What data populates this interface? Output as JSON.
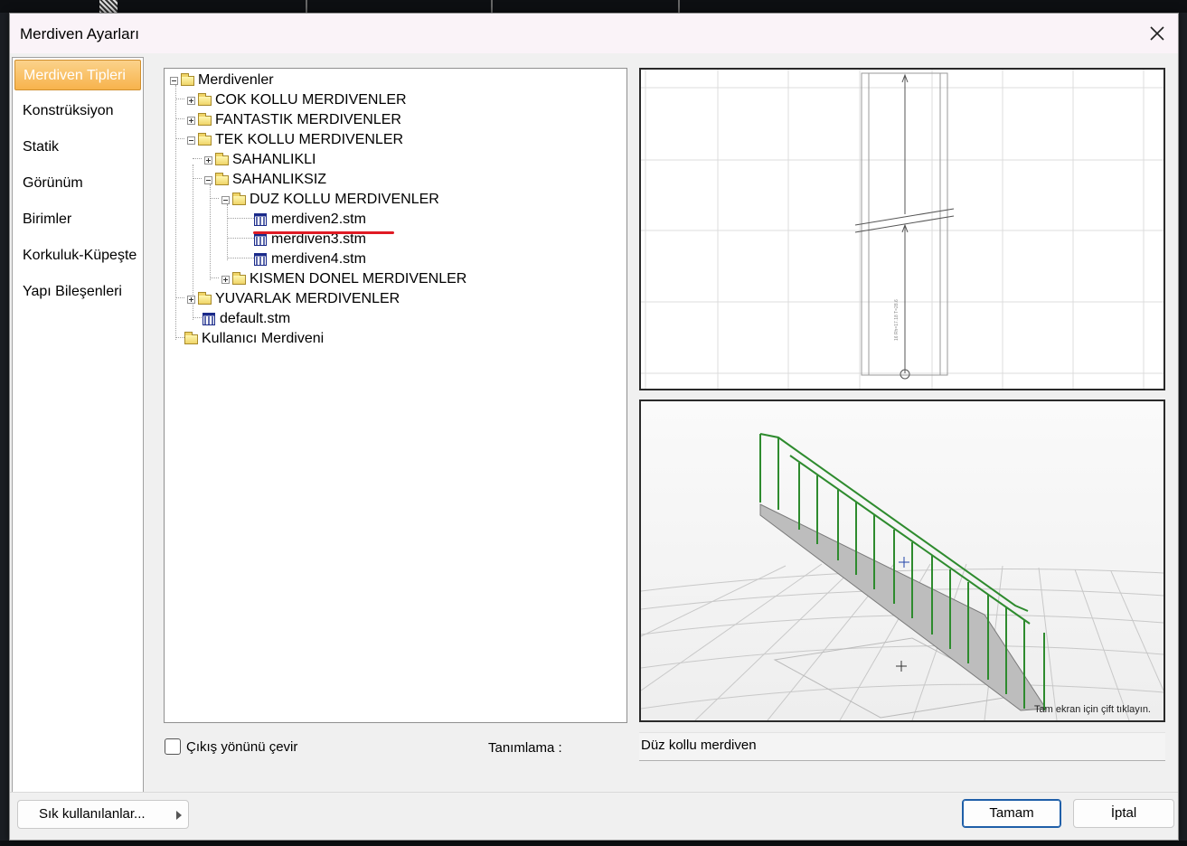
{
  "dialog": {
    "title": "Merdiven Ayarları"
  },
  "nav": {
    "items": [
      {
        "label": "Merdiven Tipleri",
        "active": true
      },
      {
        "label": "Konstrüksiyon"
      },
      {
        "label": "Statik"
      },
      {
        "label": "Görünüm"
      },
      {
        "label": "Birimler"
      },
      {
        "label": "Korkuluk-Küpeşte"
      },
      {
        "label": "Yapı Bileşenleri"
      }
    ]
  },
  "tree": {
    "nodes": [
      {
        "label": "Merdivenler",
        "type": "folder",
        "expander": "minus"
      },
      {
        "label": "COK KOLLU MERDIVENLER",
        "type": "folder",
        "expander": "plus"
      },
      {
        "label": "FANTASTIK MERDIVENLER",
        "type": "folder",
        "expander": "plus"
      },
      {
        "label": "TEK KOLLU MERDIVENLER",
        "type": "folder",
        "expander": "minus"
      },
      {
        "label": "SAHANLIKLI",
        "type": "folder",
        "expander": "plus"
      },
      {
        "label": "SAHANLIKSIZ",
        "type": "folder",
        "expander": "minus"
      },
      {
        "label": "DUZ KOLLU MERDIVENLER",
        "type": "folder",
        "expander": "minus"
      },
      {
        "label": "merdiven2.stm",
        "type": "file",
        "selected": true
      },
      {
        "label": "merdiven3.stm",
        "type": "file"
      },
      {
        "label": "merdiven4.stm",
        "type": "file"
      },
      {
        "label": "KISMEN DONEL MERDIVENLER",
        "type": "folder",
        "expander": "plus"
      },
      {
        "label": "YUVARLAK MERDIVENLER",
        "type": "folder",
        "expander": "plus"
      },
      {
        "label": "default.stm",
        "type": "file"
      },
      {
        "label": "Kullanıcı Merdiveni",
        "type": "folder"
      }
    ]
  },
  "preview": {
    "plan_dimension_text": "16 Rh=17.18 T=28.6",
    "hint": "Tam ekran için çift tıklayın."
  },
  "options": {
    "flip_exit_label": "Çıkış yönünü çevir",
    "flip_exit_checked": false,
    "description_label": "Tanımlama :",
    "description_value": "Düz kollu merdiven"
  },
  "footer": {
    "favorites_label": "Sık kullanılanlar...",
    "ok_label": "Tamam",
    "cancel_label": "İptal"
  },
  "colors": {
    "nav_active": "#f7b34c",
    "selection_underline": "#e01b24",
    "railing_green": "#2e8b2e",
    "primary_button_border": "#1f5fa8"
  }
}
